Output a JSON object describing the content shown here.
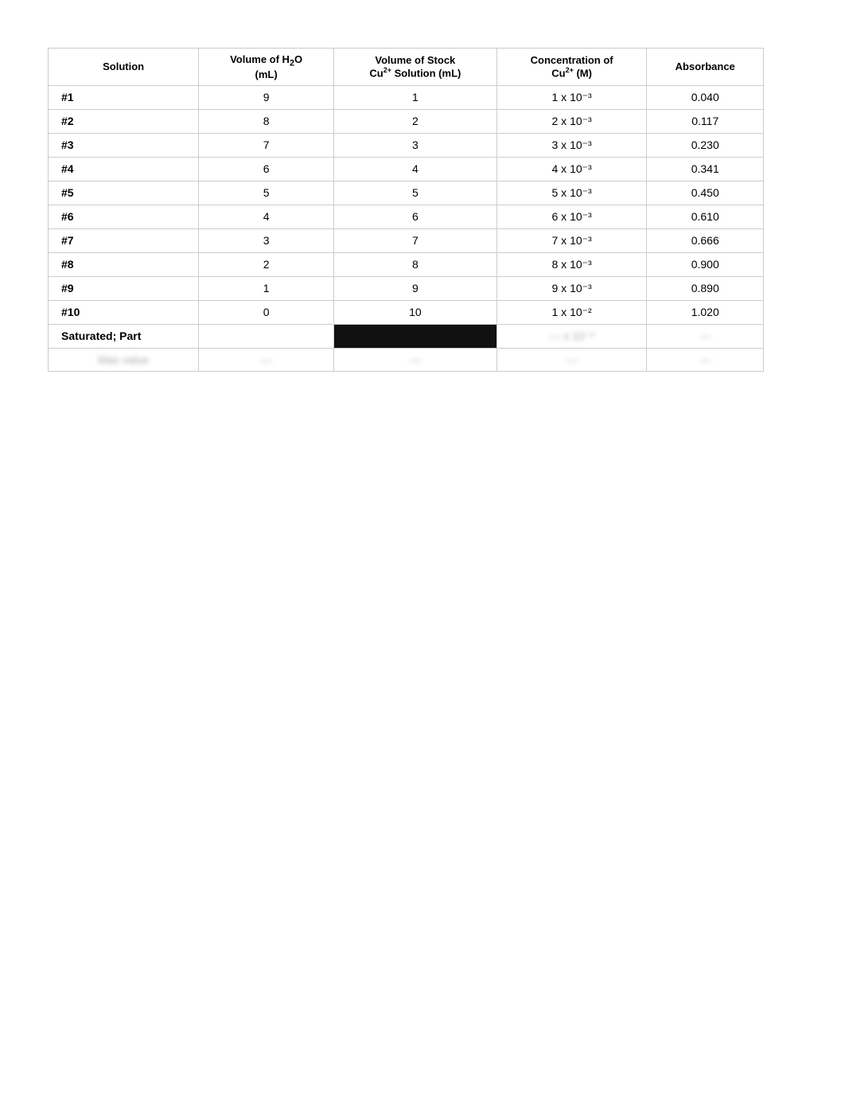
{
  "table": {
    "headers": [
      {
        "id": "solution",
        "label": "Solution"
      },
      {
        "id": "h2o",
        "label": "Volume of H₂O (mL)"
      },
      {
        "id": "stock",
        "label": "Volume of Stock Cu²⁺ Solution (mL)"
      },
      {
        "id": "concentration",
        "label": "Concentration of Cu²⁺ (M)"
      },
      {
        "id": "absorbance",
        "label": "Absorbance"
      }
    ],
    "rows": [
      {
        "solution": "#1",
        "h2o": "9",
        "stock": "1",
        "concentration": "1 x 10⁻³",
        "absorbance": "0.040"
      },
      {
        "solution": "#2",
        "h2o": "8",
        "stock": "2",
        "concentration": "2 x 10⁻³",
        "absorbance": "0.117"
      },
      {
        "solution": "#3",
        "h2o": "7",
        "stock": "3",
        "concentration": "3 x 10⁻³",
        "absorbance": "0.230"
      },
      {
        "solution": "#4",
        "h2o": "6",
        "stock": "4",
        "concentration": "4 x 10⁻³",
        "absorbance": "0.341"
      },
      {
        "solution": "#5",
        "h2o": "5",
        "stock": "5",
        "concentration": "5 x 10⁻³",
        "absorbance": "0.450"
      },
      {
        "solution": "#6",
        "h2o": "4",
        "stock": "6",
        "concentration": "6 x 10⁻³",
        "absorbance": "0.610"
      },
      {
        "solution": "#7",
        "h2o": "3",
        "stock": "7",
        "concentration": "7 x 10⁻³",
        "absorbance": "0.666"
      },
      {
        "solution": "#8",
        "h2o": "2",
        "stock": "8",
        "concentration": "8 x 10⁻³",
        "absorbance": "0.900"
      },
      {
        "solution": "#9",
        "h2o": "1",
        "stock": "9",
        "concentration": "9 x 10⁻³",
        "absorbance": "0.890"
      },
      {
        "solution": "#10",
        "h2o": "0",
        "stock": "10",
        "concentration": "1 x 10⁻²",
        "absorbance": "1.020"
      }
    ],
    "saturated_label": "Saturated; Part"
  }
}
